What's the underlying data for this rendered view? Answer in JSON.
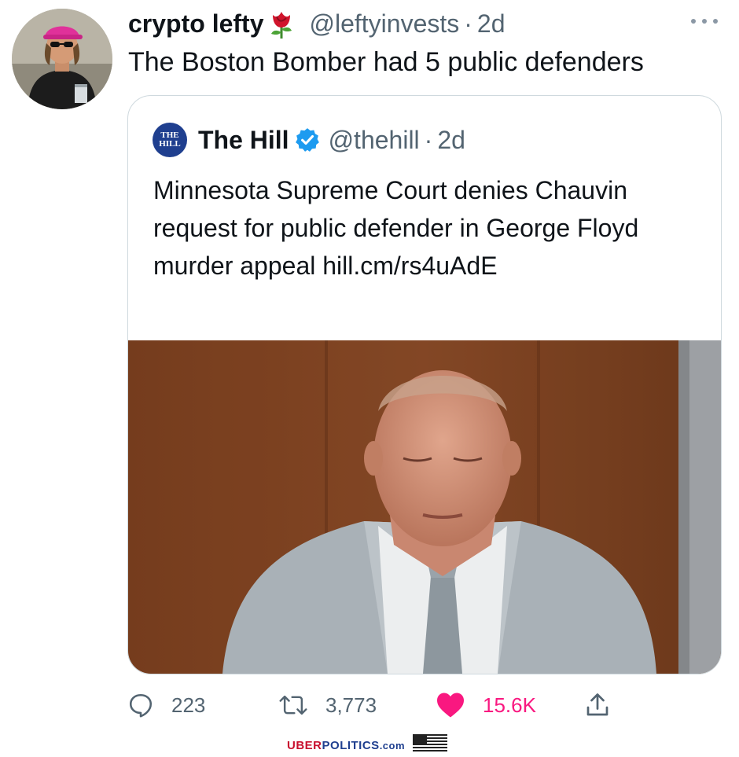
{
  "tweet": {
    "display_name": "crypto lefty",
    "emoji_icon": "rose-icon",
    "handle": "@leftyinvests",
    "separator": "·",
    "time": "2d",
    "text": "The Boston Bomber had 5 public defenders",
    "more_icon": "more-options-icon"
  },
  "quote": {
    "logo_line1": "THE",
    "logo_line2": "HILL",
    "display_name": "The Hill",
    "verified_icon": "verified-badge-icon",
    "handle": "@thehill",
    "separator": "·",
    "time": "2d",
    "text": "Minnesota Supreme Court denies Chauvin request for public defender in George Floyd murder appeal hill.cm/rs4uAdE"
  },
  "actions": {
    "reply_count": "223",
    "retweet_count": "3,773",
    "like_count": "15.6K",
    "share_icon": "share-icon"
  },
  "watermark": {
    "part1": "UBER",
    "part2": "POLITICS",
    "part3": ".com"
  },
  "colors": {
    "text_primary": "#0f1419",
    "text_secondary": "#536471",
    "like_pink": "#f91880",
    "verified_blue": "#1d9bf0",
    "border": "#cfd9de"
  }
}
